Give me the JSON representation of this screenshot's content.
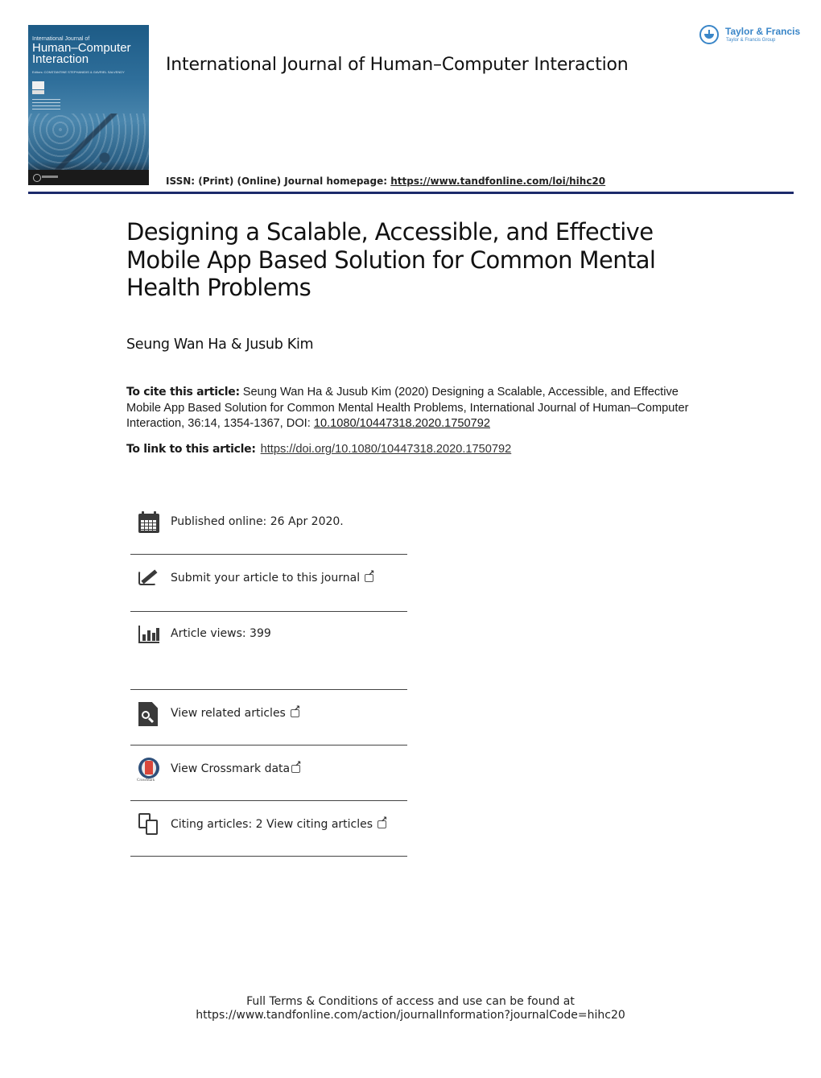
{
  "cover": {
    "small_title": "International Journal of",
    "big_title_line1": "Human–Computer",
    "big_title_line2": "Interaction",
    "editors": "Editors: CONSTANTINE STEPHANIDIS & GAVRIEL SALVENDY"
  },
  "header": {
    "journal_title": "International Journal of Human–Computer Interaction",
    "issn_label": "ISSN: (Print) (Online) Journal homepage: ",
    "homepage_url": "https://www.tandfonline.com/loi/hihc20"
  },
  "publisher": {
    "name": "Taylor & Francis",
    "group": "Taylor & Francis Group",
    "brand_color": "#3a86c8"
  },
  "article": {
    "title": "Designing a Scalable, Accessible, and Effective Mobile App Based Solution for Common Mental Health Problems",
    "authors": "Seung Wan Ha & Jusub Kim",
    "cite_label": "To cite this article:",
    "cite_text": " Seung Wan Ha & Jusub Kim (2020) Designing a Scalable, Accessible, and Effective Mobile App Based Solution for Common Mental Health Problems, International Journal of Human–Computer Interaction, 36:14, 1354-1367, DOI: ",
    "cite_doi": "10.1080/10447318.2020.1750792",
    "link_label": "To link to this article:",
    "link_url": "https://doi.org/10.1080/10447318.2020.1750792"
  },
  "info_items": [
    {
      "icon": "calendar-icon",
      "label": "Published online: 26 Apr 2020.",
      "external": false
    },
    {
      "icon": "edit-icon",
      "label": "Submit your article to this journal",
      "external": true
    },
    {
      "icon": "bar-chart-icon",
      "label": "Article views: 399",
      "external": false
    },
    {
      "icon": "search-document-icon",
      "label": "View related articles",
      "external": true
    },
    {
      "icon": "crossmark-icon",
      "label": "View Crossmark data",
      "external": true,
      "icon_caption": "CrossMark"
    },
    {
      "icon": "copy-icon",
      "label": "Citing articles: 2 View citing articles",
      "external": true
    }
  ],
  "footer": {
    "line1": "Full Terms & Conditions of access and use can be found at",
    "line2": "https://www.tandfonline.com/action/journalInformation?journalCode=hihc20"
  },
  "colors": {
    "header_rule": "#1c2a6b",
    "text": "#1a1a1a"
  }
}
